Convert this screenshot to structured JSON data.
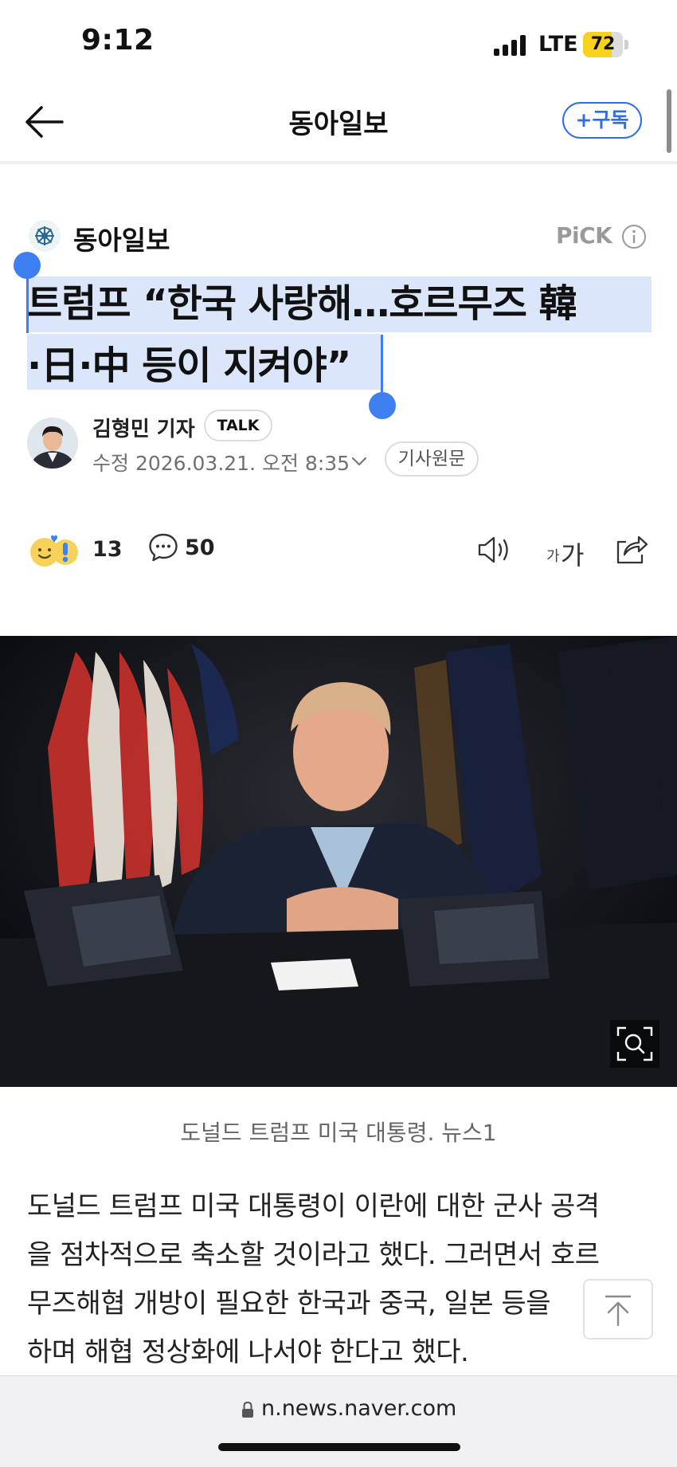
{
  "status_bar": {
    "time": "9:12",
    "network": "LTE",
    "battery": "72",
    "battery_level": 0.72
  },
  "nav": {
    "title": "동아일보",
    "subscribe_label": "+구독"
  },
  "article": {
    "press_name": "동아일보",
    "pick_label": "PiCK",
    "headline_line1": "트럼프 “한국 사랑해…호르무즈 韓",
    "headline_line2": "·日·中 등이 지켜야”",
    "author": "김형민 기자",
    "talk_label": "TALK",
    "date": "수정 2026.03.21. 오전 8:35",
    "original_label": "기사원문",
    "reaction_count": "13",
    "comment_count": "50",
    "font_size_small": "가",
    "font_size_large": "가",
    "photo_caption": "도널드 트럼프 미국 대통령. 뉴스1",
    "body_lines": [
      "도널드 트럼프 미국 대통령이 이란에 대한 군사 공격",
      "을 점차적으로 축소할 것이라고 했다. 그러면서 호르",
      "무즈해협 개방이 필요한 한국과 중국, 일본 등을",
      "하며 해협 정상화에 나서야 한다고 했다."
    ]
  },
  "browser": {
    "url": "n.news.naver.com"
  },
  "colors": {
    "accent": "#2f6ce8",
    "selection": "#dbe6fb",
    "handle": "#3d7ff0",
    "battery": "#f7d21a"
  }
}
